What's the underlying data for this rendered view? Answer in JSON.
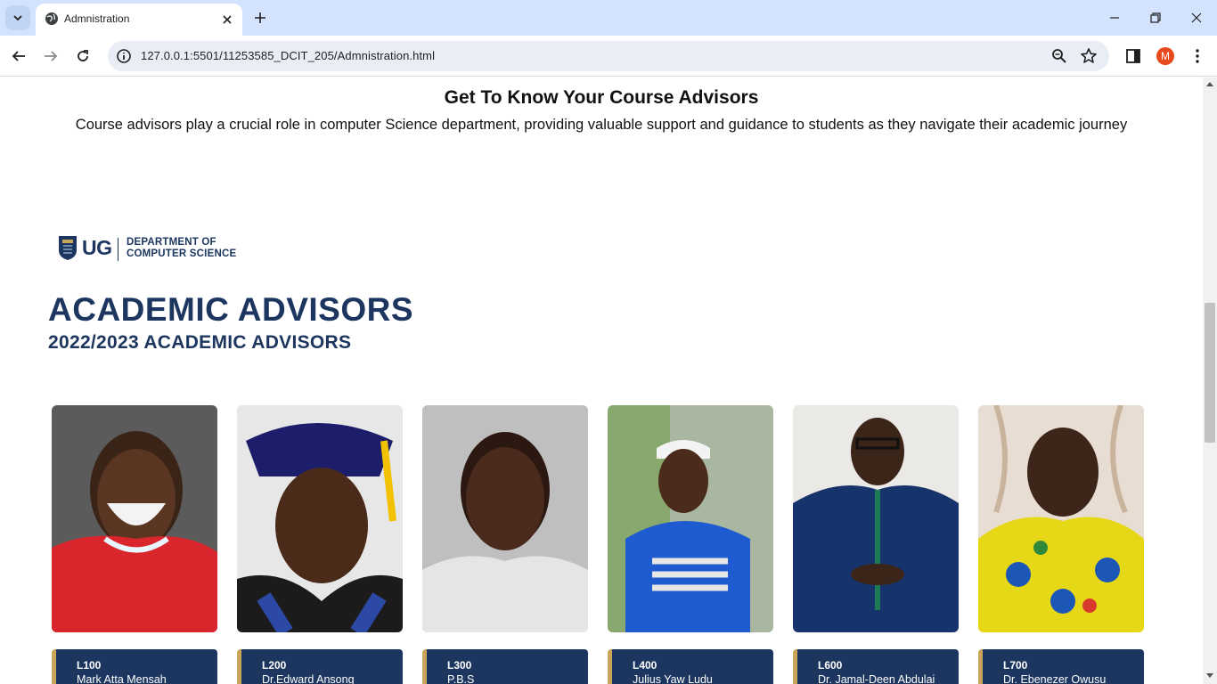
{
  "browser": {
    "tab_title": "Admnistration",
    "url": "127.0.0.1:5501/11253585_DCIT_205/Admnistration.html",
    "profile_initial": "M"
  },
  "page": {
    "heading": "Get To Know Your Course Advisors",
    "intro": "Course advisors play a crucial role in computer Science department, providing valuable support and guidance to students as they navigate their academic journey"
  },
  "poster": {
    "logo_text": "UG",
    "dept_line1": "DEPARTMENT OF",
    "dept_line2": "COMPUTER SCIENCE",
    "title": "ACADEMIC ADVISORS",
    "subtitle": "2022/2023 ACADEMIC ADVISORS",
    "brand_color": "#1d3660",
    "accent_color": "#c9a55a",
    "advisors": [
      {
        "level": "L100",
        "name": "Mark Atta Mensah"
      },
      {
        "level": "L200",
        "name": "Dr.Edward Ansong"
      },
      {
        "level": "L300",
        "name": "P.B.S"
      },
      {
        "level": "L400",
        "name": "Julius Yaw Ludu"
      },
      {
        "level": "L600",
        "name": "Dr. Jamal-Deen Abdulai"
      },
      {
        "level": "L700",
        "name": "Dr. Ebenezer Owusu"
      }
    ]
  },
  "icons": {
    "tab_search": "chevron-down-icon",
    "favicon": "globe-icon",
    "close": "close-icon",
    "new_tab": "plus-icon",
    "back": "arrow-left-icon",
    "forward": "arrow-right-icon",
    "reload": "reload-icon",
    "site_info": "info-icon",
    "zoom": "zoom-icon",
    "bookmark": "star-icon",
    "side_panel": "side-panel-icon",
    "menu": "kebab-menu-icon"
  }
}
